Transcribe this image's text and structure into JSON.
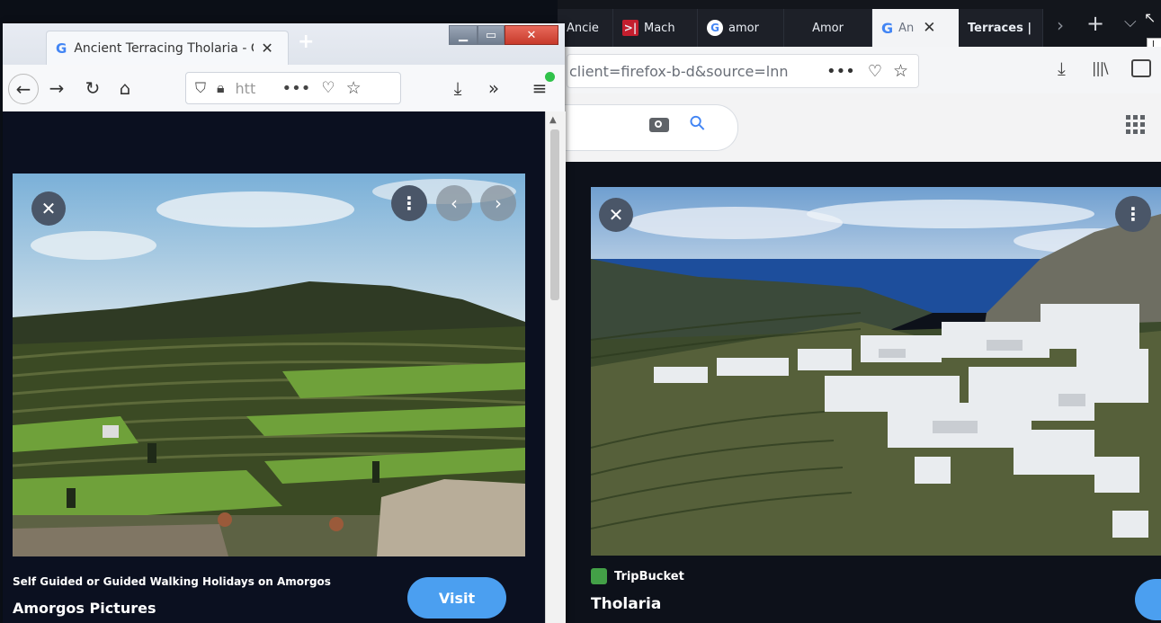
{
  "right_browser": {
    "tabs": [
      {
        "label": "Ancie",
        "icon": "tab-icon-blank"
      },
      {
        "label": "Mach",
        "icon": "red-arrows-icon"
      },
      {
        "label": "amor",
        "icon": "google-icon"
      },
      {
        "label": "Amor",
        "icon": "tab-icon-blank"
      },
      {
        "label": "An",
        "icon": "google-icon",
        "active": true
      },
      {
        "label": "Terraces |",
        "icon": "tab-icon-blank"
      }
    ],
    "url_fragment": "client=firefox-b-d&source=lnn",
    "result_source": "TripBucket",
    "result_title": "Tholaria"
  },
  "left_browser": {
    "tab_title": "Ancient Terracing Tholaria - Go",
    "url_fragment": "htt",
    "result_subtitle": "Self Guided or Guided Walking Holidays on Amorgos",
    "result_title": "Amorgos Pictures",
    "visit_label": "Visit"
  },
  "colors": {
    "accent_blue": "#4b9ff0",
    "close_red": "#d9392b",
    "viewer_bg": "#0b1020"
  }
}
